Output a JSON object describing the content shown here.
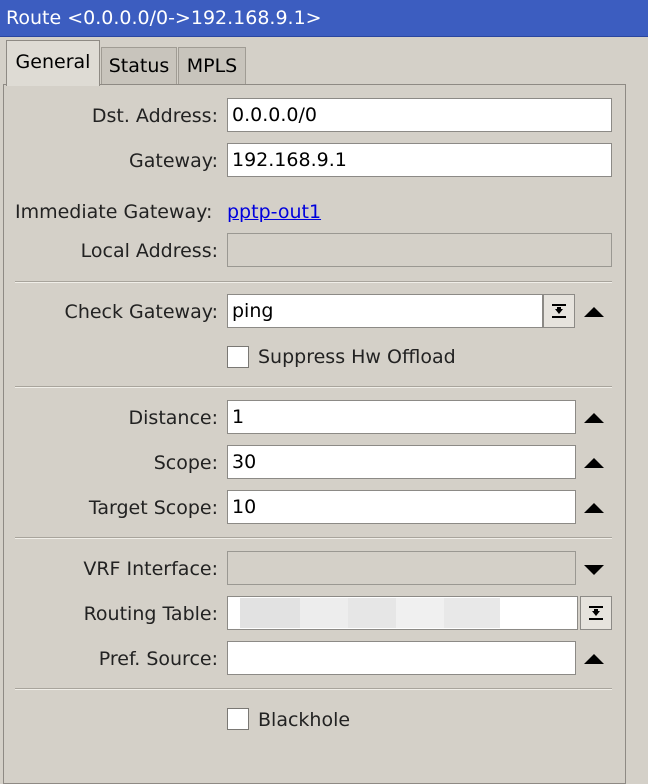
{
  "window": {
    "title": "Route <0.0.0.0/0->192.168.9.1>"
  },
  "tabs": [
    {
      "label": "General",
      "active": true
    },
    {
      "label": "Status",
      "active": false
    },
    {
      "label": "MPLS",
      "active": false
    }
  ],
  "general": {
    "dst_address": {
      "label": "Dst. Address:",
      "value": "0.0.0.0/0"
    },
    "gateway": {
      "label": "Gateway:",
      "value": "192.168.9.1"
    },
    "immediate_gateway": {
      "label": "Immediate Gateway:",
      "value": "pptp-out1"
    },
    "local_address": {
      "label": "Local Address:",
      "value": ""
    },
    "check_gateway": {
      "label": "Check Gateway:",
      "value": "ping"
    },
    "suppress_hw_offload": {
      "label": "Suppress Hw Offload",
      "checked": false
    },
    "distance": {
      "label": "Distance:",
      "value": "1"
    },
    "scope": {
      "label": "Scope:",
      "value": "30"
    },
    "target_scope": {
      "label": "Target Scope:",
      "value": "10"
    },
    "vrf_interface": {
      "label": "VRF Interface:",
      "value": ""
    },
    "routing_table": {
      "label": "Routing Table:",
      "value": ""
    },
    "pref_source": {
      "label": "Pref. Source:",
      "value": ""
    },
    "blackhole": {
      "label": "Blackhole",
      "checked": false
    }
  },
  "colors": {
    "titlebar": "#3c5dc0",
    "window_bg": "#d4d0c8",
    "link": "#0000dd"
  },
  "icons": [
    "dropdown-arrow-icon",
    "collapse-up-icon",
    "expand-down-icon"
  ]
}
